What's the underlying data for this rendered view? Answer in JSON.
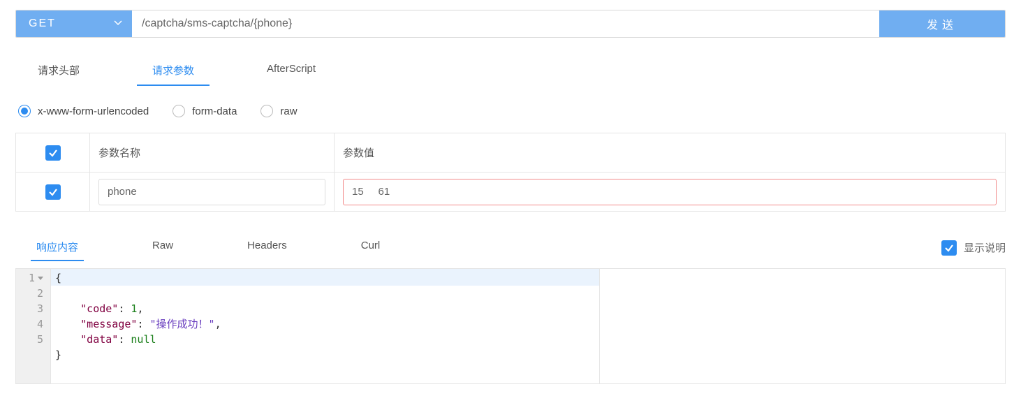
{
  "request": {
    "method": "GET",
    "url": "/captcha/sms-captcha/{phone}",
    "send_label": "发送"
  },
  "req_tabs": {
    "headers": "请求头部",
    "params": "请求参数",
    "afterscript": "AfterScript",
    "active": "params"
  },
  "body_types": {
    "urlencoded": "x-www-form-urlencoded",
    "formdata": "form-data",
    "raw": "raw",
    "selected": "urlencoded"
  },
  "param_table": {
    "header_name": "参数名称",
    "header_value": "参数值",
    "rows": [
      {
        "enabled": true,
        "name": "phone",
        "value": "15     61"
      }
    ]
  },
  "resp_tabs": {
    "body": "响应内容",
    "raw": "Raw",
    "headers": "Headers",
    "curl": "Curl",
    "active": "body"
  },
  "show_desc": {
    "label": "显示说明",
    "checked": true
  },
  "response_json": {
    "lines": [
      "1",
      "2",
      "3",
      "4",
      "5"
    ],
    "content": {
      "l1": "{",
      "l2_key": "\"code\"",
      "l2_sep": ": ",
      "l2_val": "1",
      "l2_end": ",",
      "l3_key": "\"message\"",
      "l3_sep": ": ",
      "l3_val": "\"操作成功！\"",
      "l3_end": ",",
      "l4_key": "\"data\"",
      "l4_sep": ": ",
      "l4_val": "null",
      "l5": "}"
    }
  }
}
